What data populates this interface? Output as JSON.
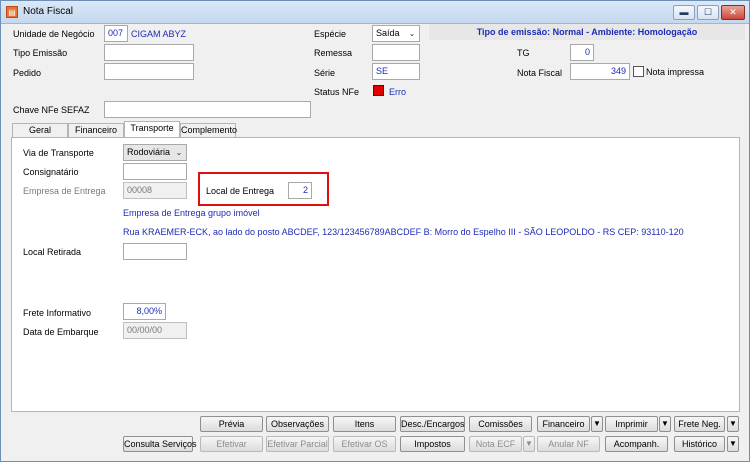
{
  "window": {
    "title": "Nota Fiscal",
    "app_icon": "document-app-icon",
    "controls": [
      "minimize-icon",
      "maximize-icon",
      "close-icon"
    ],
    "control_glyphs": {
      "minimize": "▬",
      "maximize": "☐",
      "close": "✕"
    }
  },
  "header": {
    "unidade_label": "Unidade de Negócio",
    "unidade_code": "007",
    "unidade_name": "CIGAM ABYZ",
    "tipo_emissao_label": "Tipo Emissão",
    "tipo_emissao_value": "",
    "pedido_label": "Pedido",
    "pedido_value": "",
    "especie_label": "Espécie",
    "especie_value": "Saída",
    "remessa_label": "Remessa",
    "remessa_value": "",
    "serie_label": "Série",
    "serie_value": "SE",
    "status_label": "Status NFe",
    "status_value": "Erro",
    "status_color": "#e00000",
    "banner": "Tipo de emissão: Normal - Ambiente: Homologação",
    "tg_label": "TG",
    "tg_value": "0",
    "nota_label": "Nota Fiscal",
    "nota_value": "349",
    "nota_impressa_label": "Nota impressa",
    "chave_label": "Chave NFe SEFAZ",
    "chave_value": ""
  },
  "tabs": [
    "Geral",
    "Financeiro",
    "Transporte",
    "Complemento"
  ],
  "active_tab": "Transporte",
  "transporte": {
    "via_label": "Via de Transporte",
    "via_value": "Rodoviária",
    "consignatario_label": "Consignatário",
    "consignatario_value": "",
    "empresa_label": "Empresa de Entrega",
    "empresa_value": "00008",
    "local_entrega_label": "Local de Entrega",
    "local_entrega_value": "2",
    "empresa_desc": "Empresa de Entrega grupo imóvel",
    "address": "Rua KRAEMER-ECK, ao lado do posto ABCDEF, 123/123456789ABCDEF B: Morro do Espelho III - SÃO LEOPOLDO - RS CEP: 93110-120",
    "local_retirada_label": "Local Retirada",
    "local_retirada_value": "",
    "frete_label": "Frete Informativo",
    "frete_value": "8,00%",
    "data_embarque_label": "Data de Embarque",
    "data_embarque_value": "00/00/00"
  },
  "buttons_row1": {
    "previa": "Prévia",
    "observacoes": "Observações",
    "itens": "Itens",
    "desc_encargos": "Desc./Encargos",
    "comissoes": "Comissões",
    "financeiro": "Financeiro",
    "imprimir": "Imprimir",
    "frete_neg": "Frete Neg."
  },
  "buttons_row2": {
    "consulta_servicos": "Consulta Serviços",
    "efetivar": "Efetivar",
    "efetivar_parcial": "Efetivar Parcial",
    "efetivar_os": "Efetivar OS",
    "impostos": "Impostos",
    "nota_ecf": "Nota ECF",
    "anular_nf": "Anular NF",
    "acompanh": "Acompanh.",
    "historico": "Histórico"
  },
  "dropdown_glyph": "▼"
}
